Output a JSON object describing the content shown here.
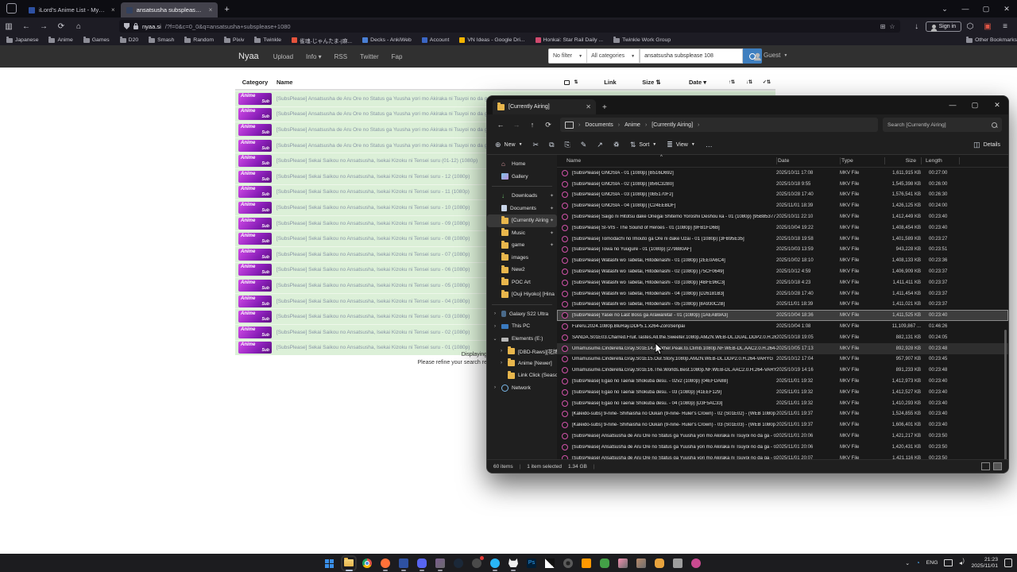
{
  "browser": {
    "tabs": [
      {
        "title": "iLord's Anime List - MyAnimeL...",
        "favicon_color": "#2e51a2",
        "close": "×"
      },
      {
        "title": "ansatsusha subsplease 1080 : ...",
        "favicon_color": "#33415e",
        "close": "×",
        "active": true
      }
    ],
    "new_tab_button": "+",
    "window_controls": {
      "tabs_menu": "⌄",
      "minimize": "—",
      "maximize": "▢",
      "close": "✕"
    },
    "url": {
      "host": "nyaa.si",
      "path": "/?f=0&c=0_0&q=ansatsusha+subsplease+1080"
    },
    "sign_in_label": "Sign in",
    "other_bookmarks_label": "Other Bookmarks",
    "bookmarks": [
      {
        "label": "Japanese",
        "type": "folder"
      },
      {
        "label": "Anime",
        "type": "folder"
      },
      {
        "label": "Games",
        "type": "folder"
      },
      {
        "label": "D20",
        "type": "folder"
      },
      {
        "label": "Smash",
        "type": "folder"
      },
      {
        "label": "Random",
        "type": "folder"
      },
      {
        "label": "Pixiv",
        "type": "folder"
      },
      {
        "label": "Twinkle",
        "type": "folder"
      },
      {
        "label": "雀魂-じゃんたま-|麻...",
        "type": "site",
        "color": "#e5533c"
      },
      {
        "label": "Decks - AnkiWeb",
        "type": "site",
        "color": "#4a7fd4"
      },
      {
        "label": "Account",
        "type": "site",
        "color": "#3b66c4"
      },
      {
        "label": "VN Ideas - Google Dri...",
        "type": "site",
        "color": "#f4b400"
      },
      {
        "label": "Honkai: Star Rail Daily ...",
        "type": "site",
        "color": "#d04a6e"
      },
      {
        "label": "Twinkle Work Group",
        "type": "folder"
      }
    ]
  },
  "nyaa": {
    "brand": "Nyaa",
    "nav_links": [
      "Upload",
      "Info",
      "RSS",
      "Twitter",
      "Fap"
    ],
    "filter_select": "No filter",
    "category_select": "All categories",
    "search_value": "ansatsusha subsplease 108",
    "guest_label": "Guest",
    "headers": {
      "category": "Category",
      "name": "Name",
      "link": "Link",
      "size": "Size",
      "date": "Date"
    },
    "rows": [
      {
        "category": "Anime Sub",
        "name": "[SubsPlease] Ansatsusha de Aru Ore no Status ga Yuusha yori mo Akiraka ni Tsuyoi no da ga"
      },
      {
        "category": "Anime Sub",
        "name": "[SubsPlease] Ansatsusha de Aru Ore no Status ga Yuusha yori mo Akiraka ni Tsuyoi no da ga"
      },
      {
        "category": "Anime Sub",
        "name": "[SubsPlease] Ansatsusha de Aru Ore no Status ga Yuusha yori mo Akiraka ni Tsuyoi no da ga"
      },
      {
        "category": "Anime Sub",
        "name": "[SubsPlease] Ansatsusha de Aru Ore no Status ga Yuusha yori mo Akiraka ni Tsuyoi no da ga"
      },
      {
        "category": "Anime Sub",
        "name": "[SubsPlease] Sekai Saikou no Ansatsusha, Isekai Kizoku ni Tensei suru (01-12) (1080p)"
      },
      {
        "category": "Anime Sub",
        "name": "[SubsPlease] Sekai Saikou no Ansatsusha, Isekai Kizoku ni Tensei suru - 12 (1080p)"
      },
      {
        "category": "Anime Sub",
        "name": "[SubsPlease] Sekai Saikou no Ansatsusha, Isekai Kizoku ni Tensei suru - 11 (1080p)"
      },
      {
        "category": "Anime Sub",
        "name": "[SubsPlease] Sekai Saikou no Ansatsusha, Isekai Kizoku ni Tensei suru - 10 (1080p)"
      },
      {
        "category": "Anime Sub",
        "name": "[SubsPlease] Sekai Saikou no Ansatsusha, Isekai Kizoku ni Tensei suru - 09 (1080p)"
      },
      {
        "category": "Anime Sub",
        "name": "[SubsPlease] Sekai Saikou no Ansatsusha, Isekai Kizoku ni Tensei suru - 08 (1080p)"
      },
      {
        "category": "Anime Sub",
        "name": "[SubsPlease] Sekai Saikou no Ansatsusha, Isekai Kizoku ni Tensei suru - 07 (1080p)"
      },
      {
        "category": "Anime Sub",
        "name": "[SubsPlease] Sekai Saikou no Ansatsusha, Isekai Kizoku ni Tensei suru - 06 (1080p)"
      },
      {
        "category": "Anime Sub",
        "name": "[SubsPlease] Sekai Saikou no Ansatsusha, Isekai Kizoku ni Tensei suru - 05 (1080p)"
      },
      {
        "category": "Anime Sub",
        "name": "[SubsPlease] Sekai Saikou no Ansatsusha, Isekai Kizoku ni Tensei suru - 04 (1080p)"
      },
      {
        "category": "Anime Sub",
        "name": "[SubsPlease] Sekai Saikou no Ansatsusha, Isekai Kizoku ni Tensei suru - 03 (1080p)"
      },
      {
        "category": "Anime Sub",
        "name": "[SubsPlease] Sekai Saikou no Ansatsusha, Isekai Kizoku ni Tensei suru - 02 (1080p)"
      },
      {
        "category": "Anime Sub",
        "name": "[SubsPlease] Sekai Saikou no Ansatsusha, Isekai Kizoku ni Tensei suru - 01 (1080p)"
      }
    ],
    "footer_line1": "Displaying",
    "footer_line2": "Please refine your search re"
  },
  "explorer": {
    "tab_title": "[Currently Airing]",
    "window_controls": {
      "minimize": "—",
      "maximize": "▢",
      "close": "✕"
    },
    "breadcrumb": [
      "Documents",
      "Anime",
      "[Currently Airing]"
    ],
    "search_placeholder": "Search [Currently Airing]",
    "toolbar": {
      "new": "New",
      "sort": "Sort",
      "view": "View",
      "more": "…",
      "details": "Details"
    },
    "columns": [
      "Name",
      "Date",
      "Type",
      "Size",
      "Length"
    ],
    "sidebar": [
      {
        "label": "Home",
        "icon": "home"
      },
      {
        "label": "Gallery",
        "icon": "gallery"
      },
      {
        "label": "Downloads",
        "icon": "download",
        "pinned": true,
        "divider": true
      },
      {
        "label": "Documents",
        "icon": "document",
        "pinned": true
      },
      {
        "label": "[Currently Airing",
        "icon": "folder",
        "pinned": true,
        "selected": true
      },
      {
        "label": "Music",
        "icon": "folder",
        "pinned": true
      },
      {
        "label": "game",
        "icon": "folder",
        "pinned": true
      },
      {
        "label": "images",
        "icon": "folder"
      },
      {
        "label": "New2",
        "icon": "folder"
      },
      {
        "label": "POC Art",
        "icon": "folder"
      },
      {
        "label": "[Ouji Hiyoko] [Hina",
        "icon": "folder"
      },
      {
        "label": "Galaxy S22 Ultra",
        "icon": "phone",
        "chevron": "›",
        "divider": true
      },
      {
        "label": "This PC",
        "icon": "monitor",
        "chevron": "›"
      },
      {
        "label": "Elements (E:)",
        "icon": "drive",
        "chevron": "⌄"
      },
      {
        "label": "[DBD-Raws][花牌",
        "icon": "folder",
        "chevron": "›",
        "indent": 1
      },
      {
        "label": "Anime [Newer]",
        "icon": "folder",
        "chevron": "›",
        "indent": 1
      },
      {
        "label": "Link Click (Season",
        "icon": "folder",
        "indent": 1
      },
      {
        "label": "Network",
        "icon": "network",
        "chevron": "›"
      }
    ],
    "files": [
      {
        "name": "[SubsPlease] GNOSIA - 01 (1080p) [B516D692]",
        "date": "2025/10/11 17:08",
        "type": "MKV File",
        "size": "1,611,915 KB",
        "length": "00:27:00"
      },
      {
        "name": "[SubsPlease] GNOSIA - 02 (1080p) [856C32B0]",
        "date": "2025/10/18 9:55",
        "type": "MKV File",
        "size": "1,545,398 KB",
        "length": "00:26:00"
      },
      {
        "name": "[SubsPlease] GNOSIA - 03 (1080p) [0B5170F2]",
        "date": "2025/10/28 17:40",
        "type": "MKV File",
        "size": "1,576,541 KB",
        "length": "00:26:30"
      },
      {
        "name": "[SubsPlease] GNOSIA - 04 (1080p) [C24EEBDF]",
        "date": "2025/11/01 18:39",
        "type": "MKV File",
        "size": "1,426,125 KB",
        "length": "00:24:00"
      },
      {
        "name": "[SubsPlease] Saigo ni Hitotsu dake Onegai Shitemo Yoroshii Deshou ka - 01 (1080p) [95B85377]",
        "date": "2025/10/11 22:10",
        "type": "MKV File",
        "size": "1,412,449 KB",
        "length": "00:23:40"
      },
      {
        "name": "[SubsPlease] SI-VIS - The Sound of Heroes - 01 (1080p) [9FB1FD6B]",
        "date": "2025/10/04 19:22",
        "type": "MKV File",
        "size": "1,408,454 KB",
        "length": "00:23:40"
      },
      {
        "name": "[SubsPlease] Tomodachi no Imouto ga Ore ni dake Uzai - 01 (1080p) [3FB95E35]",
        "date": "2025/10/18 19:58",
        "type": "MKV File",
        "size": "1,401,589 KB",
        "length": "00:23:27"
      },
      {
        "name": "[SubsPlease] Towa no Yuugure - 01 (1080p) [279880AF]",
        "date": "2025/10/03 13:59",
        "type": "MKV File",
        "size": "943,228 KB",
        "length": "00:23:51"
      },
      {
        "name": "[SubsPlease] Watashi wo Tabetai, Hitodenashi - 01 (1080p) [2EE0A6C4]",
        "date": "2025/10/02 18:10",
        "type": "MKV File",
        "size": "1,408,133 KB",
        "length": "00:23:36"
      },
      {
        "name": "[SubsPlease] Watashi wo Tabetai, Hitodenashi - 02 (1080p) [75CF0649]",
        "date": "2025/10/12 4:59",
        "type": "MKV File",
        "size": "1,406,909 KB",
        "length": "00:23:37"
      },
      {
        "name": "[SubsPlease] Watashi wo Tabetai, Hitodenashi - 03 (1080p) [4BFE96C3]",
        "date": "2025/10/18 4:23",
        "type": "MKV File",
        "size": "1,411,411 KB",
        "length": "00:23:37"
      },
      {
        "name": "[SubsPlease] Watashi wo Tabetai, Hitodenashi - 04 (1080p) [D26181B3]",
        "date": "2025/10/28 17:40",
        "type": "MKV File",
        "size": "1,411,454 KB",
        "length": "00:23:37"
      },
      {
        "name": "[SubsPlease] Watashi wo Tabetai, Hitodenashi - 05 (1080p) [8A930C2B]",
        "date": "2025/11/01 18:39",
        "type": "MKV File",
        "size": "1,411,021 KB",
        "length": "00:23:37"
      },
      {
        "name": "[SubsPlease] Yasei no Last Boss ga Arawareta! - 01 (1080p) [1AEAB9A3]",
        "date": "2025/10/04 18:36",
        "type": "MKV File",
        "size": "1,411,525 KB",
        "length": "00:23:40",
        "state": "selected"
      },
      {
        "name": "Fureru.2024.1080p.BluRay.DDP5.1.x264-ZoroSenpai",
        "date": "2025/10/04 1:08",
        "type": "MKV File",
        "size": "11,109,867 ...",
        "length": "01:46:26"
      },
      {
        "name": "SANDA.S01E03.Charred.Fruit.Tastes.All.the.Sweeter.1080p.AMZN.WEB-DL.DUAL.DDP2.0.H.264-VA...",
        "date": "2025/10/18 19:05",
        "type": "MKV File",
        "size": "882,131 KB",
        "length": "00:24:05"
      },
      {
        "name": "Umamusume.Cinderella.Gray.S01E14.Another.Peak.to.Climb.1080p.NF.WEB-DL.AAC2.0.H.264-VA...",
        "date": "2025/10/05 17:13",
        "type": "MKV File",
        "size": "892,928 KB",
        "length": "00:23:48",
        "state": "hover"
      },
      {
        "name": "Umamusume.Cinderella.Gray.S01E15.Our.Story.1080p.AMZN.WEB-DL.DDP2.0.H.264-VARYG",
        "date": "2025/10/12 17:04",
        "type": "MKV File",
        "size": "957,907 KB",
        "length": "00:23:45"
      },
      {
        "name": "Umamusume.Cinderella.Gray.S01E16.The.Worlds.Best.1080p.NF.WEB-DL.AAC2.0.H.264-VARYG",
        "date": "2025/10/19 14:16",
        "type": "MKV File",
        "size": "891,233 KB",
        "length": "00:23:48"
      },
      {
        "name": "[SubsPlease] Egao no Taenai Shokuba desu. - 02v2 (1080p) [04EFDA8B]",
        "date": "2025/11/01 19:32",
        "type": "MKV File",
        "size": "1,412,973 KB",
        "length": "00:23:40"
      },
      {
        "name": "[SubsPlease] Egao no Taenai Shokuba desu. - 03 (1080p) [41EEF129]",
        "date": "2025/11/01 19:32",
        "type": "MKV File",
        "size": "1,412,527 KB",
        "length": "00:23:40"
      },
      {
        "name": "[SubsPlease] Egao no Taenai Shokuba desu. - 04 (1080p) [D3F5AC33]",
        "date": "2025/11/01 19:32",
        "type": "MKV File",
        "size": "1,410,293 KB",
        "length": "00:23:40"
      },
      {
        "name": "[Kaleido-subs] 9-nine- Shihaisha no Oukan (9-nine- Ruler's Crown) - 02 (S01E02) - (WEB 1080p H...",
        "date": "2025/11/01 19:37",
        "type": "MKV File",
        "size": "1,524,855 KB",
        "length": "00:23:40"
      },
      {
        "name": "[Kaleido-subs] 9-nine- Shihaisha no Oukan (9-nine- Ruler's Crown) - 03 (S01E03) - (WEB 1080p H...",
        "date": "2025/11/01 19:37",
        "type": "MKV File",
        "size": "1,606,401 KB",
        "length": "00:23:40"
      },
      {
        "name": "[SubsPlease] Ansatsusha de Aru Ore no Status ga Yuusha yori mo Akiraka ni Tsuyoi no da ga - 02 ...",
        "date": "2025/11/01 20:06",
        "type": "MKV File",
        "size": "1,421,217 KB",
        "length": "00:23:50"
      },
      {
        "name": "[SubsPlease] Ansatsusha de Aru Ore no Status ga Yuusha yori mo Akiraka ni Tsuyoi no da ga - 03 ...",
        "date": "2025/11/01 20:06",
        "type": "MKV File",
        "size": "1,420,431 KB",
        "length": "00:23:50"
      },
      {
        "name": "[SubsPlease] Ansatsusha de Aru Ore no Status ga Yuusha yori mo Akiraka ni Tsuyoi no da ga - 04 ...",
        "date": "2025/11/01 20:07",
        "type": "MKV File",
        "size": "1,421,116 KB",
        "length": "00:23:50"
      }
    ],
    "status": {
      "items": "60 items",
      "selected": "1 item selected",
      "size": "1.34 GB"
    }
  },
  "taskbar": {
    "icons": [
      {
        "name": "start",
        "color": "#3a8fe8",
        "shape": "win"
      },
      {
        "name": "file-explorer",
        "color": "#e8b64c",
        "shape": "folder",
        "state": "focused"
      },
      {
        "name": "chrome",
        "color": "#de5246",
        "shape": "chrome"
      },
      {
        "name": "firefox",
        "color": "#ff7139",
        "shape": "circle",
        "running": true
      },
      {
        "name": "myanimelist-app",
        "color": "#2e51a2",
        "shape": "square",
        "running": true
      },
      {
        "name": "discord",
        "color": "#5865f2",
        "shape": "rounded",
        "running": true
      },
      {
        "name": "photos-app",
        "color": "#7a5c8e",
        "shape": "image",
        "running": true
      },
      {
        "name": "steam",
        "color": "#1b2838",
        "shape": "circle"
      },
      {
        "name": "geforce-experience",
        "color": "#4a4a4a",
        "shape": "circle",
        "badge": true
      },
      {
        "name": "drop-app",
        "color": "#29b6f6",
        "shape": "drop",
        "running": true
      },
      {
        "name": "cat-app",
        "color": "#f0f0f0",
        "shape": "cat",
        "running": true
      },
      {
        "name": "photoshop",
        "color": "#001e36",
        "shape": "ps",
        "text": "Ps"
      },
      {
        "name": "wallpaper-engine",
        "color": "#111111",
        "shape": "triangle"
      },
      {
        "name": "settings-app",
        "color": "#5a5a5a",
        "shape": "gear"
      },
      {
        "name": "sublime-app",
        "color": "#ff9800",
        "shape": "square"
      },
      {
        "name": "line-app",
        "color": "#43a047",
        "shape": "rounded"
      },
      {
        "name": "anime-app-1",
        "color": "#f48fb1",
        "shape": "image"
      },
      {
        "name": "anime-app-2",
        "color": "#b98a6a",
        "shape": "image"
      },
      {
        "name": "card-app",
        "color": "#e8a33d",
        "shape": "rounded"
      },
      {
        "name": "gray-app",
        "color": "#9e9e9e",
        "shape": "square"
      },
      {
        "name": "osu-app",
        "color": "#c94a90",
        "shape": "circle"
      }
    ],
    "tray": {
      "chevron": "⌄",
      "lang": "ENG",
      "time": "21:23",
      "date": "2025/11/01"
    }
  }
}
